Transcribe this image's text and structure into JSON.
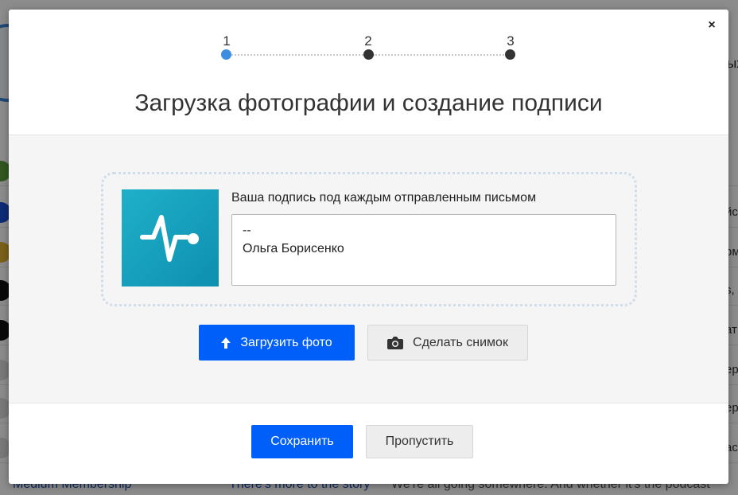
{
  "background": {
    "row_tails": [
      "йс",
      "ом",
      "",
      "s, h",
      "ат",
      "ер",
      "ер",
      "ас"
    ],
    "header_tail": "ых",
    "last_row": {
      "sender": "Medium Membership",
      "subject": "There's more to the story",
      "snippet": "We're all going somewhere. And whether it's the podcast"
    }
  },
  "modal": {
    "close_icon": "×",
    "steps": [
      "1",
      "2",
      "3"
    ],
    "active_step": 1,
    "title": "Загрузка фотографии и создание подписи",
    "signature": {
      "label": "Ваша подпись под каждым отправленным письмом",
      "lines": [
        "--",
        "Ольга Борисенко"
      ]
    },
    "upload_button": "Загрузить фото",
    "snapshot_button": "Сделать снимок",
    "save_button": "Сохранить",
    "skip_button": "Пропустить"
  },
  "colors": {
    "accent": "#005ff9",
    "active_step": "#3d8de0",
    "avatar_bg": "#1aa5c2"
  },
  "icons": {
    "close": "close-icon",
    "upload": "arrow-up-icon",
    "snapshot": "camera-icon",
    "avatar": "pulse-icon"
  }
}
